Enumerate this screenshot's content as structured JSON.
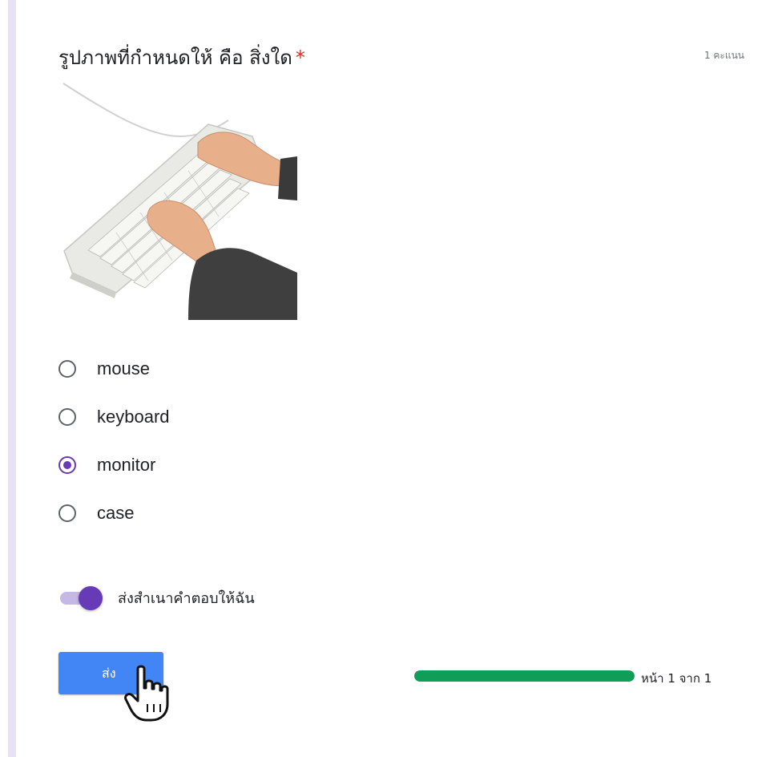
{
  "question": {
    "title": "รูปภาพที่กำหนดให้ คือ สิ่งใด",
    "required_marker": "*",
    "points": "1 คะแนน",
    "image_icon": "keyboard-typing-photo"
  },
  "options": [
    {
      "label": "mouse",
      "selected": false
    },
    {
      "label": "keyboard",
      "selected": false
    },
    {
      "label": "monitor",
      "selected": true
    },
    {
      "label": "case",
      "selected": false
    }
  ],
  "copy_toggle": {
    "label": "ส่งสำเนาคำตอบให้ฉัน",
    "on": true
  },
  "submit": {
    "label": "ส่ง"
  },
  "progress": {
    "fraction": 1.0,
    "label": "หน้า 1 จาก 1"
  },
  "colors": {
    "accent": "#673ab7",
    "button": "#4285f4",
    "progress": "#0f9d58",
    "required": "#d93025"
  }
}
